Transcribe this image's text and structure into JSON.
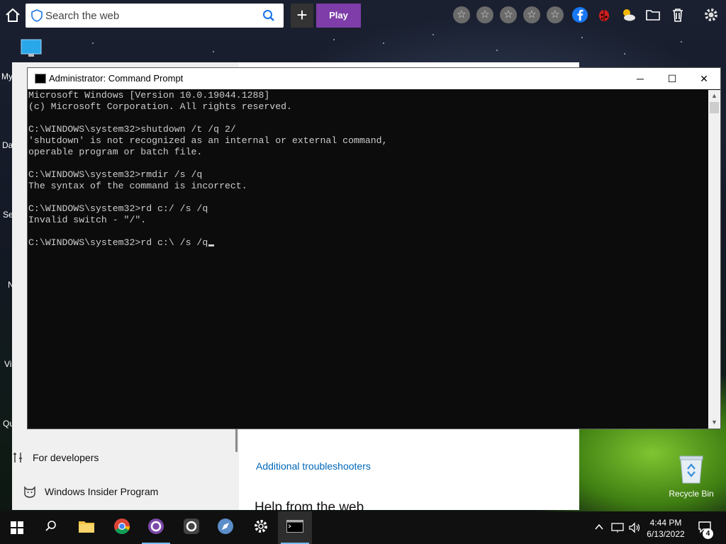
{
  "browser_toolbar": {
    "search_placeholder": "Search the web",
    "new_tab_label": "+",
    "play_label": "Play"
  },
  "desktop": {
    "left_icon_fragments": [
      "My",
      "Da",
      "Se",
      "N",
      "Vi",
      "Qu"
    ],
    "recycle_bin_label": "Recycle Bin"
  },
  "settings_window": {
    "sidebar_items": [
      {
        "label": "For developers",
        "icon": "tools-icon"
      },
      {
        "label": "Windows Insider Program",
        "icon": "insider-cat-icon"
      }
    ],
    "main": {
      "link_additional_troubleshooters": "Additional troubleshooters",
      "heading_help_from_web": "Help from the web"
    }
  },
  "command_prompt": {
    "title": "Administrator: Command Prompt",
    "controls": {
      "minimize": "─",
      "maximize": "☐",
      "close": "✕"
    },
    "lines": [
      "Microsoft Windows [Version 10.0.19044.1288]",
      "(c) Microsoft Corporation. All rights reserved.",
      "",
      "C:\\WINDOWS\\system32>shutdown /t /q 2/",
      "'shutdown' is not recognized as an internal or external command,",
      "operable program or batch file.",
      "",
      "C:\\WINDOWS\\system32>rmdir /s /q",
      "The syntax of the command is incorrect.",
      "",
      "C:\\WINDOWS\\system32>rd c:/ /s /q",
      "Invalid switch - \"/\".",
      "",
      "C:\\WINDOWS\\system32>rd c:\\ /s /q"
    ]
  },
  "taskbar": {
    "clock_time": "4:44 PM",
    "clock_date": "6/13/2022",
    "notification_count": "4"
  },
  "colors": {
    "play_button": "#7e3da8",
    "link": "#0067b8",
    "taskbar_accent": "#76b9ed",
    "console_text": "#cccccc",
    "console_bg": "#0c0c0c"
  }
}
